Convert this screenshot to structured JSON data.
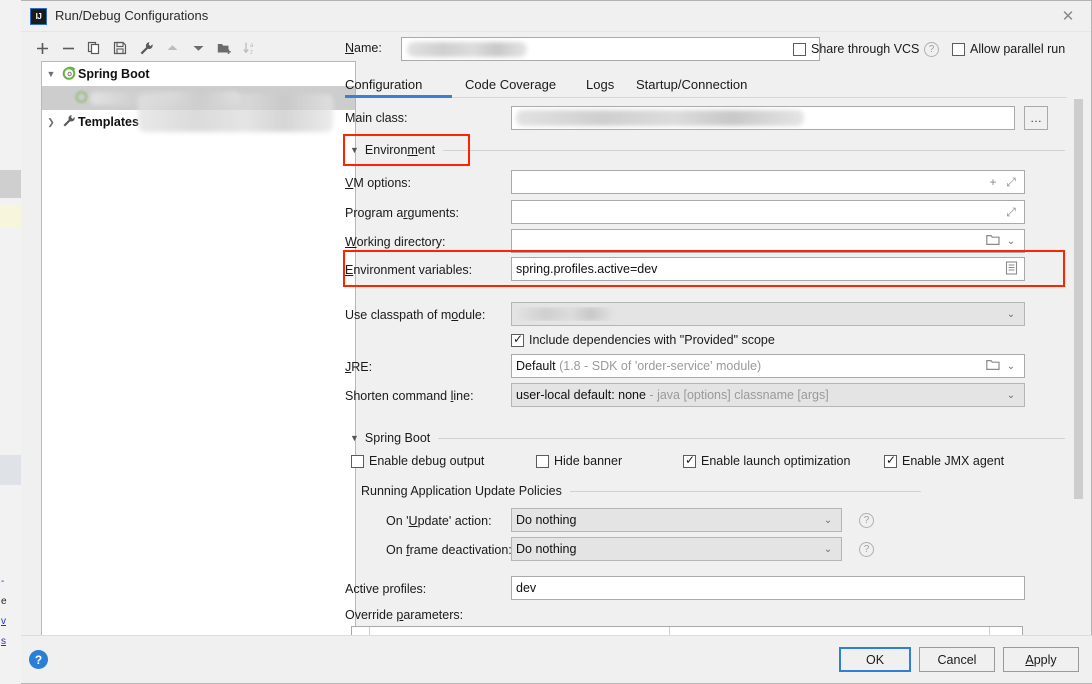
{
  "window": {
    "title": "Run/Debug Configurations",
    "logo_text": "IJ",
    "close_icon": "close-icon"
  },
  "left_toolbar": {
    "items": [
      {
        "name": "add-configuration",
        "glyph": "+",
        "dim": false
      },
      {
        "name": "remove-configuration",
        "glyph": "−",
        "dim": false
      },
      {
        "name": "copy-configuration",
        "glyph": "🗐",
        "dim": false
      },
      {
        "name": "save-configuration",
        "glyph": "🖫",
        "dim": false
      },
      {
        "name": "edit-templates",
        "glyph": "🔧",
        "dim": false
      },
      {
        "name": "move-up",
        "glyph": "▲",
        "dim": true
      },
      {
        "name": "move-down",
        "glyph": "▼",
        "dim": false
      },
      {
        "name": "create-folder",
        "glyph": "🗀",
        "dim": false
      },
      {
        "name": "sort-configurations",
        "glyph": "↓",
        "dim": true
      }
    ]
  },
  "tree": {
    "nodes": [
      {
        "label": "Spring Boot",
        "expanded": true,
        "icon": "spring-boot-icon",
        "selected": false,
        "redacted": false
      },
      {
        "label": "",
        "expanded": false,
        "icon": "spring-boot-icon",
        "selected": true,
        "redacted": true
      },
      {
        "label": "Templates",
        "expanded": false,
        "icon": "wrench-icon",
        "selected": false,
        "redacted": false
      }
    ]
  },
  "name_field": {
    "label": "Name:",
    "value": "",
    "redacted": true
  },
  "header_checkboxes": [
    {
      "label": "Share through VCS",
      "checked": false,
      "help": true
    },
    {
      "label": "Allow parallel run",
      "checked": false,
      "help": false
    }
  ],
  "tabs": [
    {
      "label": "Configuration",
      "active": true
    },
    {
      "label": "Code Coverage",
      "active": false
    },
    {
      "label": "Logs",
      "active": false
    },
    {
      "label": "Startup/Connection",
      "active": false
    }
  ],
  "form": {
    "main_class": {
      "label": "Main class:",
      "value": "",
      "redacted": true,
      "browse_label": "..."
    },
    "environment_section": {
      "label": "Environment",
      "expanded": true,
      "highlighted": true
    },
    "vm_options": {
      "label": "VM options:",
      "value": "",
      "icons": [
        "plus-icon",
        "expand-icon"
      ]
    },
    "program_arguments": {
      "label": "Program arguments:",
      "value": "",
      "icons": [
        "expand-icon"
      ]
    },
    "working_directory": {
      "label": "Working directory:",
      "value": "",
      "icons": [
        "folder-icon",
        "chevron-down-icon"
      ]
    },
    "environment_variables": {
      "label": "Environment variables:",
      "value": "spring.profiles.active=dev",
      "icons": [
        "list-editor-icon"
      ],
      "highlighted": true
    },
    "use_classpath_of_module": {
      "label": "Use classpath of module:",
      "value": "",
      "redacted": true,
      "icons": [
        "chevron-down-icon"
      ]
    },
    "include_provided": {
      "label": "Include dependencies with \"Provided\" scope",
      "checked": true
    },
    "jre": {
      "label": "JRE:",
      "value": "Default",
      "hint": "(1.8 - SDK of 'order-service' module)",
      "icons": [
        "folder-icon",
        "chevron-down-icon"
      ]
    },
    "shorten_command_line": {
      "label": "Shorten command line:",
      "value": "user-local default: none",
      "hint": "- java [options] classname [args]",
      "icons": [
        "chevron-down-icon"
      ]
    },
    "spring_boot_section": {
      "label": "Spring Boot",
      "expanded": true
    },
    "spring_boot_checkboxes": [
      {
        "label": "Enable debug output",
        "checked": false
      },
      {
        "label": "Hide banner",
        "checked": false
      },
      {
        "label": "Enable launch optimization",
        "checked": true
      },
      {
        "label": "Enable JMX agent",
        "checked": true
      }
    ],
    "update_policies_section": {
      "label": "Running Application Update Policies"
    },
    "on_update_action": {
      "label": "On 'Update' action:",
      "value": "Do nothing",
      "help": true
    },
    "on_frame_deactivation": {
      "label": "On frame deactivation:",
      "value": "Do nothing",
      "help": true
    },
    "active_profiles": {
      "label": "Active profiles:",
      "value": "dev"
    },
    "override_parameters": {
      "label": "Override parameters:"
    }
  },
  "footer": {
    "help_icon": "help-icon",
    "help_glyph": "?",
    "buttons": [
      {
        "label": "OK",
        "default": true
      },
      {
        "label": "Cancel",
        "default": false
      },
      {
        "label": "Apply",
        "default": false
      }
    ]
  },
  "colors": {
    "accent": "#3b7dd8",
    "annotation": "#ff2400",
    "help_blue": "#2a7fd4",
    "selection": "#cdcdcd"
  },
  "background_sliver": {
    "marks": [
      "-",
      "e",
      "v",
      "s"
    ]
  }
}
